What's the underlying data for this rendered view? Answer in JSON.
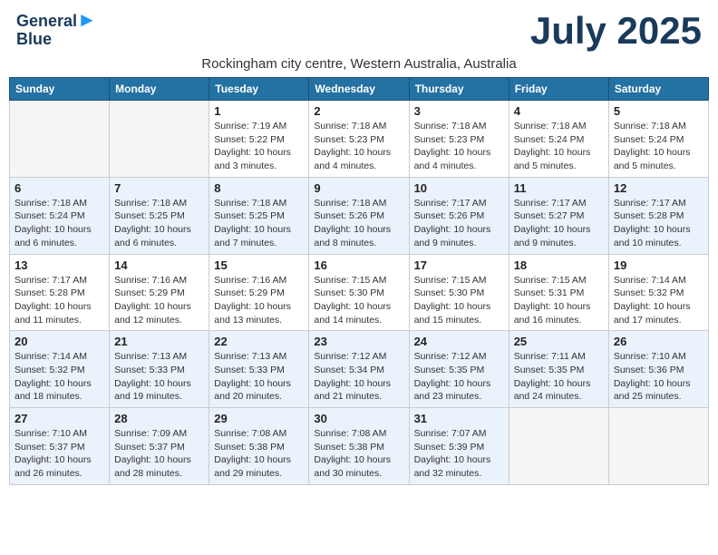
{
  "header": {
    "logo_general": "General",
    "logo_blue": "Blue",
    "title": "July 2025",
    "subtitle": "Rockingham city centre, Western Australia, Australia"
  },
  "weekdays": [
    "Sunday",
    "Monday",
    "Tuesday",
    "Wednesday",
    "Thursday",
    "Friday",
    "Saturday"
  ],
  "weeks": [
    [
      {
        "day": "",
        "empty": true
      },
      {
        "day": "",
        "empty": true
      },
      {
        "day": "1",
        "sunrise": "Sunrise: 7:19 AM",
        "sunset": "Sunset: 5:22 PM",
        "daylight": "Daylight: 10 hours and 3 minutes."
      },
      {
        "day": "2",
        "sunrise": "Sunrise: 7:18 AM",
        "sunset": "Sunset: 5:23 PM",
        "daylight": "Daylight: 10 hours and 4 minutes."
      },
      {
        "day": "3",
        "sunrise": "Sunrise: 7:18 AM",
        "sunset": "Sunset: 5:23 PM",
        "daylight": "Daylight: 10 hours and 4 minutes."
      },
      {
        "day": "4",
        "sunrise": "Sunrise: 7:18 AM",
        "sunset": "Sunset: 5:24 PM",
        "daylight": "Daylight: 10 hours and 5 minutes."
      },
      {
        "day": "5",
        "sunrise": "Sunrise: 7:18 AM",
        "sunset": "Sunset: 5:24 PM",
        "daylight": "Daylight: 10 hours and 5 minutes."
      }
    ],
    [
      {
        "day": "6",
        "sunrise": "Sunrise: 7:18 AM",
        "sunset": "Sunset: 5:24 PM",
        "daylight": "Daylight: 10 hours and 6 minutes."
      },
      {
        "day": "7",
        "sunrise": "Sunrise: 7:18 AM",
        "sunset": "Sunset: 5:25 PM",
        "daylight": "Daylight: 10 hours and 6 minutes."
      },
      {
        "day": "8",
        "sunrise": "Sunrise: 7:18 AM",
        "sunset": "Sunset: 5:25 PM",
        "daylight": "Daylight: 10 hours and 7 minutes."
      },
      {
        "day": "9",
        "sunrise": "Sunrise: 7:18 AM",
        "sunset": "Sunset: 5:26 PM",
        "daylight": "Daylight: 10 hours and 8 minutes."
      },
      {
        "day": "10",
        "sunrise": "Sunrise: 7:17 AM",
        "sunset": "Sunset: 5:26 PM",
        "daylight": "Daylight: 10 hours and 9 minutes."
      },
      {
        "day": "11",
        "sunrise": "Sunrise: 7:17 AM",
        "sunset": "Sunset: 5:27 PM",
        "daylight": "Daylight: 10 hours and 9 minutes."
      },
      {
        "day": "12",
        "sunrise": "Sunrise: 7:17 AM",
        "sunset": "Sunset: 5:28 PM",
        "daylight": "Daylight: 10 hours and 10 minutes."
      }
    ],
    [
      {
        "day": "13",
        "sunrise": "Sunrise: 7:17 AM",
        "sunset": "Sunset: 5:28 PM",
        "daylight": "Daylight: 10 hours and 11 minutes."
      },
      {
        "day": "14",
        "sunrise": "Sunrise: 7:16 AM",
        "sunset": "Sunset: 5:29 PM",
        "daylight": "Daylight: 10 hours and 12 minutes."
      },
      {
        "day": "15",
        "sunrise": "Sunrise: 7:16 AM",
        "sunset": "Sunset: 5:29 PM",
        "daylight": "Daylight: 10 hours and 13 minutes."
      },
      {
        "day": "16",
        "sunrise": "Sunrise: 7:15 AM",
        "sunset": "Sunset: 5:30 PM",
        "daylight": "Daylight: 10 hours and 14 minutes."
      },
      {
        "day": "17",
        "sunrise": "Sunrise: 7:15 AM",
        "sunset": "Sunset: 5:30 PM",
        "daylight": "Daylight: 10 hours and 15 minutes."
      },
      {
        "day": "18",
        "sunrise": "Sunrise: 7:15 AM",
        "sunset": "Sunset: 5:31 PM",
        "daylight": "Daylight: 10 hours and 16 minutes."
      },
      {
        "day": "19",
        "sunrise": "Sunrise: 7:14 AM",
        "sunset": "Sunset: 5:32 PM",
        "daylight": "Daylight: 10 hours and 17 minutes."
      }
    ],
    [
      {
        "day": "20",
        "sunrise": "Sunrise: 7:14 AM",
        "sunset": "Sunset: 5:32 PM",
        "daylight": "Daylight: 10 hours and 18 minutes."
      },
      {
        "day": "21",
        "sunrise": "Sunrise: 7:13 AM",
        "sunset": "Sunset: 5:33 PM",
        "daylight": "Daylight: 10 hours and 19 minutes."
      },
      {
        "day": "22",
        "sunrise": "Sunrise: 7:13 AM",
        "sunset": "Sunset: 5:33 PM",
        "daylight": "Daylight: 10 hours and 20 minutes."
      },
      {
        "day": "23",
        "sunrise": "Sunrise: 7:12 AM",
        "sunset": "Sunset: 5:34 PM",
        "daylight": "Daylight: 10 hours and 21 minutes."
      },
      {
        "day": "24",
        "sunrise": "Sunrise: 7:12 AM",
        "sunset": "Sunset: 5:35 PM",
        "daylight": "Daylight: 10 hours and 23 minutes."
      },
      {
        "day": "25",
        "sunrise": "Sunrise: 7:11 AM",
        "sunset": "Sunset: 5:35 PM",
        "daylight": "Daylight: 10 hours and 24 minutes."
      },
      {
        "day": "26",
        "sunrise": "Sunrise: 7:10 AM",
        "sunset": "Sunset: 5:36 PM",
        "daylight": "Daylight: 10 hours and 25 minutes."
      }
    ],
    [
      {
        "day": "27",
        "sunrise": "Sunrise: 7:10 AM",
        "sunset": "Sunset: 5:37 PM",
        "daylight": "Daylight: 10 hours and 26 minutes."
      },
      {
        "day": "28",
        "sunrise": "Sunrise: 7:09 AM",
        "sunset": "Sunset: 5:37 PM",
        "daylight": "Daylight: 10 hours and 28 minutes."
      },
      {
        "day": "29",
        "sunrise": "Sunrise: 7:08 AM",
        "sunset": "Sunset: 5:38 PM",
        "daylight": "Daylight: 10 hours and 29 minutes."
      },
      {
        "day": "30",
        "sunrise": "Sunrise: 7:08 AM",
        "sunset": "Sunset: 5:38 PM",
        "daylight": "Daylight: 10 hours and 30 minutes."
      },
      {
        "day": "31",
        "sunrise": "Sunrise: 7:07 AM",
        "sunset": "Sunset: 5:39 PM",
        "daylight": "Daylight: 10 hours and 32 minutes."
      },
      {
        "day": "",
        "empty": true
      },
      {
        "day": "",
        "empty": true
      }
    ]
  ]
}
